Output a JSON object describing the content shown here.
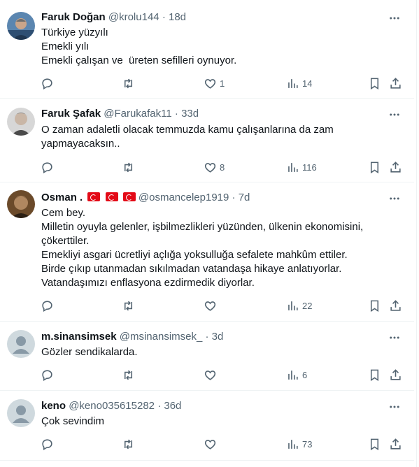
{
  "tweets": [
    {
      "name": "Faruk Doğan",
      "handle": "@krolu144",
      "time": "18d",
      "flags": 0,
      "lines": [
        "Türkiye yüzyılı",
        "Emekli yılı",
        "Emekli çalışan ve  üreten sefilleri oynuyor."
      ],
      "likes": "1",
      "views": "14",
      "avatar": "photo-blue"
    },
    {
      "name": "Faruk Şafak",
      "handle": "@Farukafak11",
      "time": "33d",
      "flags": 0,
      "lines": [
        "O zaman adaletli olacak temmuzda kamu çalışanlarına da zam",
        "yapmayacaksın.."
      ],
      "likes": "8",
      "views": "116",
      "avatar": "photo-gray"
    },
    {
      "name": "Osman .",
      "handle": "@osmancelep1919",
      "time": "7d",
      "flags": 3,
      "lines": [
        "Cem bey.",
        "Milletin oyuyla gelenler, işbilmezlikleri yüzünden, ülkenin ekonomisini,",
        "çökerttiler.",
        "Emekliyi asgari ücretliyi açlığa yoksulluğa sefalete mahkûm ettiler.",
        "Birde çıkıp utanmadan sıkılmadan vatandaşa hikaye anlatıyorlar.",
        "Vatandaşımızı enflasyona ezdirmedik diyorlar."
      ],
      "likes": "",
      "views": "22",
      "avatar": "photo-brown"
    },
    {
      "name": "m.sinansimsek",
      "handle": "@msinansimsek_",
      "time": "3d",
      "flags": 0,
      "lines": [
        "Gözler sendikalarda."
      ],
      "likes": "",
      "views": "6",
      "avatar": "default"
    },
    {
      "name": "keno",
      "handle": "@keno035615282",
      "time": "36d",
      "flags": 0,
      "lines": [
        "Çok sevindim"
      ],
      "likes": "",
      "views": "73",
      "avatar": "default"
    }
  ],
  "colors": {
    "text": "#0f1419",
    "secondary": "#536471",
    "border": "#eff3f4",
    "flag_red": "#e30a17"
  },
  "icons": [
    "reply-icon",
    "retweet-icon",
    "like-icon",
    "views-icon",
    "bookmark-icon",
    "share-icon",
    "more-icon"
  ]
}
